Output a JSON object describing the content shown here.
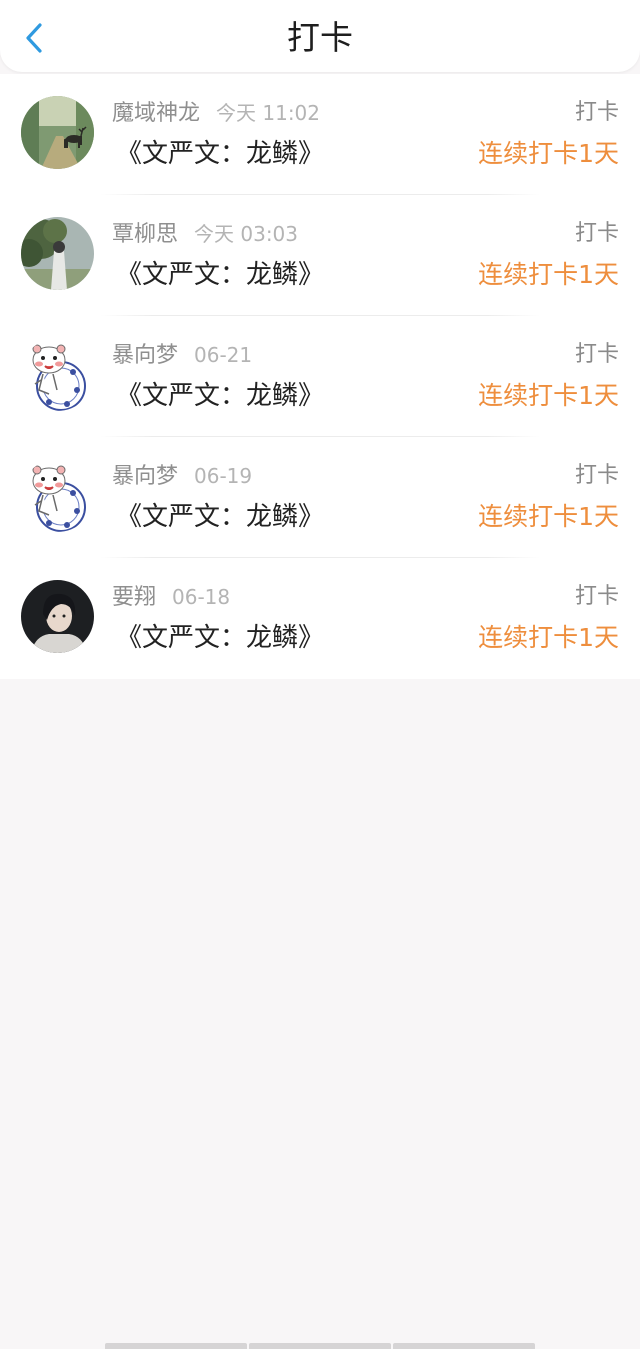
{
  "header": {
    "title": "打卡",
    "back_icon": "chevron-left-icon",
    "accent_color": "#2f9ae0"
  },
  "checkins": [
    {
      "name": "魔域神龙",
      "time": "今天 11:02",
      "book": "《文严文：龙鳞》",
      "kind": "打卡",
      "streak": "连续打卡1天",
      "avatar": "deer-forest-avatar"
    },
    {
      "name": "覃柳思",
      "time": "今天 03:03",
      "book": "《文严文：龙鳞》",
      "kind": "打卡",
      "streak": "连续打卡1天",
      "avatar": "person-tree-avatar"
    },
    {
      "name": "暴向梦",
      "time": "06-21",
      "book": "《文严文：龙鳞》",
      "kind": "打卡",
      "streak": "连续打卡1天",
      "avatar": "cartoon-tiger-avatar"
    },
    {
      "name": "暴向梦",
      "time": "06-19",
      "book": "《文严文：龙鳞》",
      "kind": "打卡",
      "streak": "连续打卡1天",
      "avatar": "cartoon-tiger-avatar"
    },
    {
      "name": "要翔",
      "time": "06-18",
      "book": "《文严文：龙鳞》",
      "kind": "打卡",
      "streak": "连续打卡1天",
      "avatar": "portrait-avatar"
    }
  ],
  "colors": {
    "streak": "#ee8e3d",
    "background": "#f8f6f7"
  }
}
